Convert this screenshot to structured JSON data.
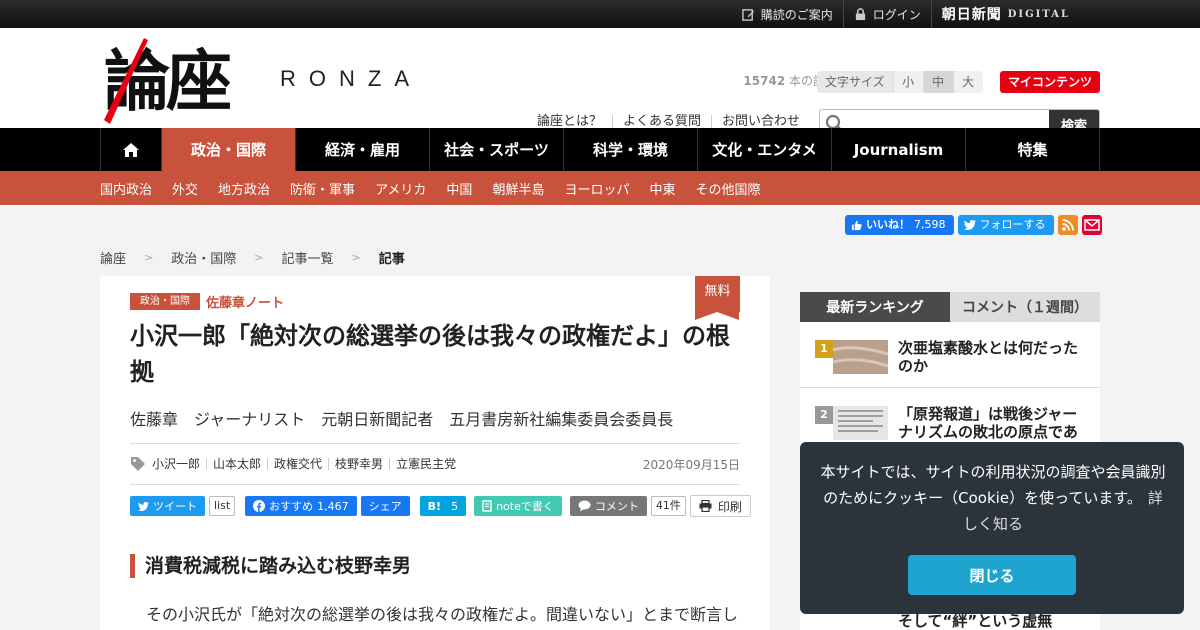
{
  "topbar": {
    "subscribe": "購読のご案内",
    "login": "ログイン",
    "asahi": "朝日新聞",
    "digital": "DIGITAL"
  },
  "logo": {
    "kanji": "論座",
    "latin": "RONZA"
  },
  "header": {
    "count_number": "15742",
    "count_text": " 本の記事が読み放題",
    "font_size_label": "文字サイズ",
    "font_sizes": [
      "小",
      "中",
      "大"
    ],
    "font_size_selected": "中",
    "my_contents": "マイコンテンツ",
    "links": [
      "論座とは？",
      "よくある質問",
      "お問い合わせ"
    ],
    "search_placeholder": "",
    "search_button": "検索"
  },
  "nav": {
    "items": [
      "政治・国際",
      "経済・雇用",
      "社会・スポーツ",
      "科学・環境",
      "文化・エンタメ",
      "Journalism",
      "特集"
    ],
    "active": "政治・国際"
  },
  "subnav": [
    "国内政治",
    "外交",
    "地方政治",
    "防衛・軍事",
    "アメリカ",
    "中国",
    "朝鮮半島",
    "ヨーロッパ",
    "中東",
    "その他国際"
  ],
  "social": {
    "fb_like": "いいね！",
    "fb_count": "7,598",
    "tw_follow": "フォローする"
  },
  "breadcrumb": [
    "論座",
    "政治・国際",
    "記事一覧",
    "記事"
  ],
  "article": {
    "badge": "無料",
    "category": "政治・国際",
    "series": "佐藤章ノート",
    "title": "小沢一郎「絶対次の総選挙の後は我々の政権だよ」の根拠",
    "author": "佐藤章　ジャーナリスト　元朝日新聞記者　五月書房新社編集委員会委員長",
    "tags": [
      "小沢一郎",
      "山本太郎",
      "政権交代",
      "枝野幸男",
      "立憲民主党"
    ],
    "date": "2020年09月15日",
    "share": {
      "tweet": "ツイート",
      "list": "list",
      "fb_recommend": "おすすめ",
      "fb_count": "1,467",
      "fb_share": "シェア",
      "hatena": "B!",
      "hatena_count": "5",
      "note": "noteで書く",
      "comment": "コメント",
      "comment_count": "41件",
      "print": "印刷"
    },
    "section_heading": "消費税減税に踏み込む枝野幸男",
    "body_first_line": "その小沢氏が「絶対次の総選挙の後は我々の政権だよ。間違いない」とまで断言し"
  },
  "ranking": {
    "tab_active": "最新ランキング",
    "tab_other": "コメント（１週間）",
    "items": [
      {
        "rank": "1",
        "title": "次亜塩素酸水とは何だったのか"
      },
      {
        "rank": "2",
        "title": "「原発報道」は戦後ジャーナリズムの敗北の原点であ"
      }
    ],
    "tail_text": "そして“絆”という虚無"
  },
  "cookie": {
    "message": "本サイトでは、サイトの利用状況の調査や会員識別のためにクッキー（Cookie）を使っています。",
    "more": "詳しく知る",
    "close": "閉じる"
  },
  "colors": {
    "accent": "#c8523c",
    "my_contents": "#e60012",
    "facebook": "#1877f2",
    "twitter": "#1d9bf0",
    "cookie_button": "#1fa4d0"
  }
}
